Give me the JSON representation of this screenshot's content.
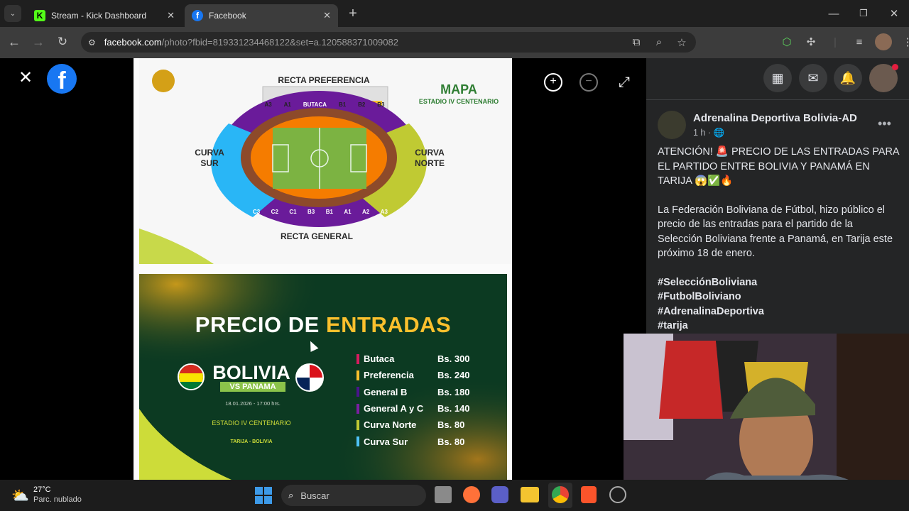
{
  "tabs": [
    {
      "title": "Stream - Kick Dashboard",
      "icon": "kick-icon",
      "active": false
    },
    {
      "title": "Facebook",
      "icon": "facebook-icon",
      "active": true
    }
  ],
  "address": {
    "host": "facebook.com",
    "path": "/photo?fbid=819331234468122&set=a.120588371009082"
  },
  "map": {
    "top_label": "RECTA PREFERENCIA",
    "bottom_label": "RECTA GENERAL",
    "left_label": "CURVA\nSUR",
    "right_label": "CURVA\nNORTE",
    "title": "MAPA",
    "subtitle": "ESTADIO IV CENTENARIO",
    "top_sections": [
      "A3",
      "A1",
      "BUTACA",
      "B1",
      "B2",
      "B3"
    ],
    "bottom_sections": [
      "C3",
      "C2",
      "C1",
      "B3",
      "B1",
      "A1",
      "A2",
      "A3"
    ]
  },
  "price": {
    "title_a": "PRECIO DE ",
    "title_b": "ENTRADAS",
    "team": "BOLIVIA",
    "vs": "VS PANAMA",
    "date": "18.01.2026 - 17:00 hrs.",
    "venue": "ESTADIO IV CENTENARIO",
    "city": "TARIJA - BOLIVIA",
    "rows": [
      {
        "name": "Butaca",
        "price": "Bs. 300",
        "color": "#d81b60"
      },
      {
        "name": "Preferencia",
        "price": "Bs. 240",
        "color": "#fbc02d"
      },
      {
        "name": "General B",
        "price": "Bs. 180",
        "color": "#4a148c"
      },
      {
        "name": "General A y C",
        "price": "Bs. 140",
        "color": "#7b1fa2"
      },
      {
        "name": "Curva Norte",
        "price": "Bs. 80",
        "color": "#c0ca33"
      },
      {
        "name": "Curva Sur",
        "price": "Bs. 80",
        "color": "#4fc3f7"
      }
    ]
  },
  "post": {
    "author": "Adrenalina Deportiva Bolivia-AD",
    "time": "1 h · ",
    "p1": "ATENCIÓN! 🚨 PRECIO DE LAS ENTRADAS PARA EL PARTIDO ENTRE BOLIVIA Y PANAMÁ EN TARIJA 😱✅🔥",
    "p2": "La Federación Boliviana de Fútbol, hizo público el precio de las entradas para el partido de la Selección Boliviana frente a Panamá, en Tarija este próximo 18 de enero.",
    "tags": [
      "#SelecciónBoliviana",
      "#FutbolBoliviano",
      "#AdrenalinaDeportiva",
      "#tarija"
    ]
  },
  "taskbar": {
    "temp": "27°C",
    "weather": "Parc. nublado",
    "search": "Buscar"
  }
}
